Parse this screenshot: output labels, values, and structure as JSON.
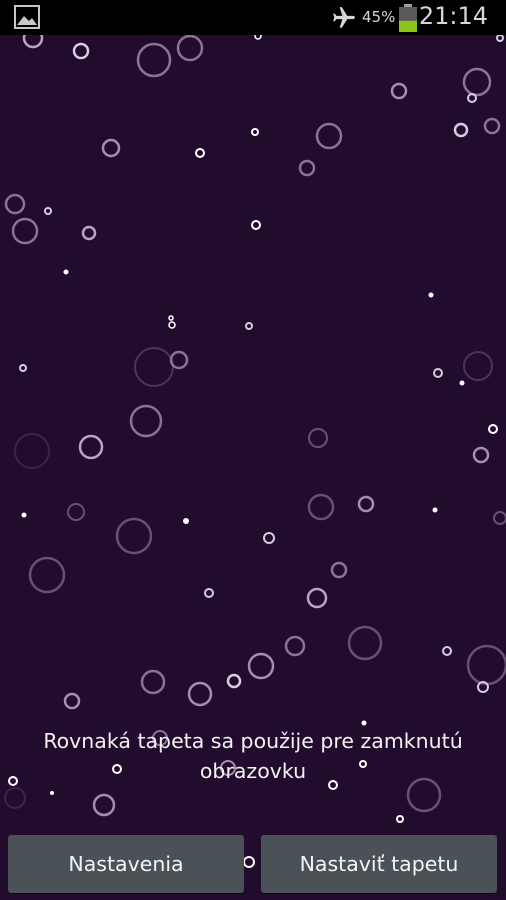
{
  "status_bar": {
    "notification_icon": "image-icon",
    "airplane_icon": "airplane-icon",
    "battery_percent": "45%",
    "battery_level": 0.45,
    "battery_color": "#8bc41b",
    "time": "21:14"
  },
  "notice": {
    "text": "Rovnaká tapeta sa použije pre zamknutú obrazovku"
  },
  "buttons": {
    "settings_label": "Nastavenia",
    "set_wallpaper_label": "Nastaviť tapetu"
  },
  "colors": {
    "background": "#220c2e",
    "button": "#4a5258"
  }
}
